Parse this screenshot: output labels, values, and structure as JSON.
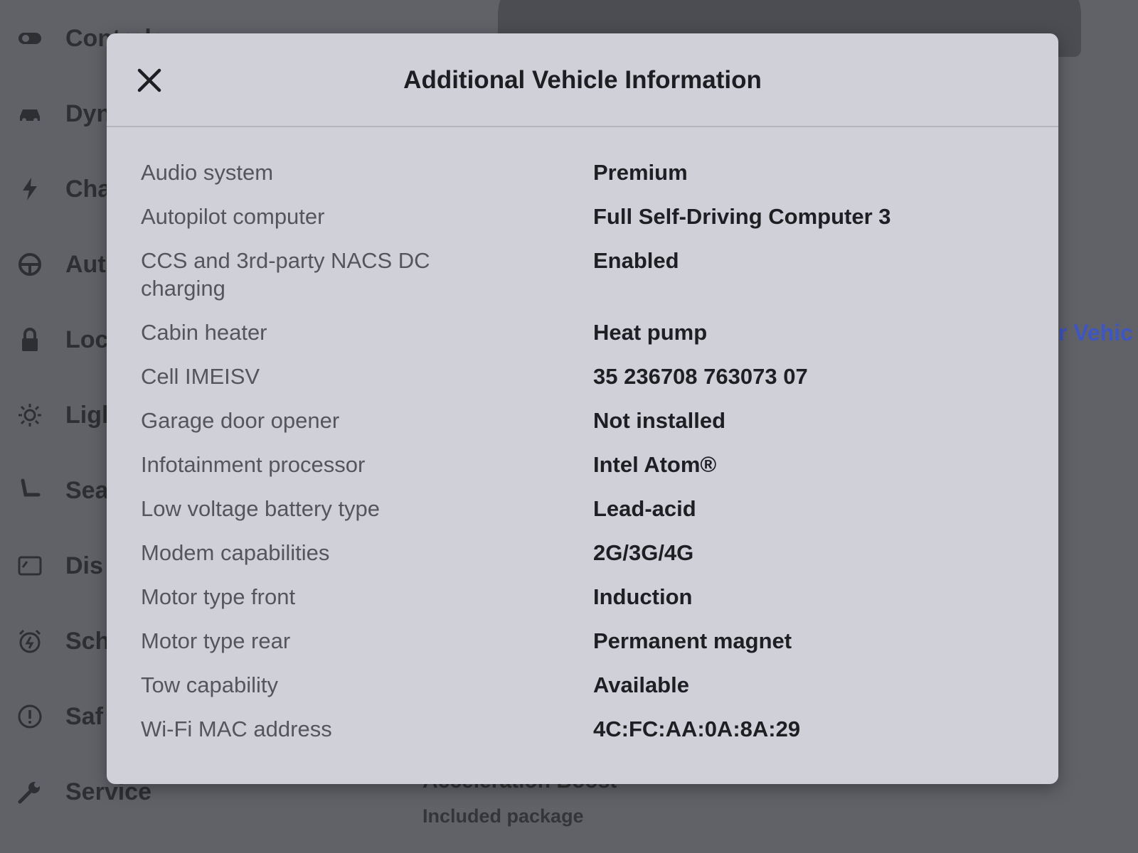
{
  "background": {
    "sidebar": {
      "items": [
        {
          "label": "Controls",
          "icon": "toggle-icon"
        },
        {
          "label": "Dyn",
          "icon": "car-icon"
        },
        {
          "label": "Cha",
          "icon": "lightning-icon"
        },
        {
          "label": "Aut",
          "icon": "steering-wheel-icon"
        },
        {
          "label": "Loc",
          "icon": "lock-icon"
        },
        {
          "label": "Ligl",
          "icon": "sun-icon"
        },
        {
          "label": "Sea",
          "icon": "seat-icon"
        },
        {
          "label": "Dis",
          "icon": "display-icon"
        },
        {
          "label": "Sch",
          "icon": "alarm-clock-icon"
        },
        {
          "label": "Saf",
          "icon": "alert-circle-icon"
        },
        {
          "label": "Service",
          "icon": "wrench-icon"
        }
      ]
    },
    "link_text": "r Vehic",
    "acceleration_text": "Acceleration Boost",
    "included_text": "Included package"
  },
  "modal": {
    "title": "Additional Vehicle Information",
    "close_icon": "close-icon",
    "rows": [
      {
        "label": "Audio system",
        "value": "Premium"
      },
      {
        "label": "Autopilot computer",
        "value": "Full Self-Driving Computer 3"
      },
      {
        "label": "CCS and 3rd-party NACS DC charging",
        "value": "Enabled"
      },
      {
        "label": "Cabin heater",
        "value": "Heat pump"
      },
      {
        "label": "Cell IMEISV",
        "value": "35 236708 763073 07"
      },
      {
        "label": "Garage door opener",
        "value": "Not installed"
      },
      {
        "label": "Infotainment processor",
        "value": "Intel Atom®"
      },
      {
        "label": "Low voltage battery type",
        "value": "Lead-acid"
      },
      {
        "label": "Modem capabilities",
        "value": "2G/3G/4G"
      },
      {
        "label": "Motor type front",
        "value": "Induction"
      },
      {
        "label": "Motor type rear",
        "value": "Permanent magnet"
      },
      {
        "label": "Tow capability",
        "value": "Available"
      },
      {
        "label": "Wi-Fi MAC address",
        "value": "4C:FC:AA:0A:8A:29"
      }
    ]
  }
}
